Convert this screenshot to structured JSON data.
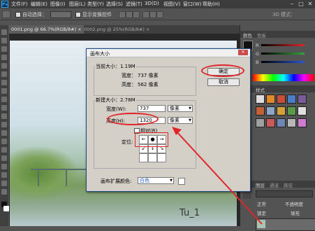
{
  "menubar": {
    "logo": "Ps",
    "items": [
      "文件(F)",
      "编辑(E)",
      "图像(I)",
      "图层(L)",
      "类型(Y)",
      "选择(S)",
      "滤镜(T)",
      "3D(D)",
      "视图(V)",
      "窗口(W)",
      "帮助(H)"
    ],
    "window_controls": [
      "‒",
      "□",
      "✕"
    ]
  },
  "optionsbar": {
    "auto_select_label": "自动选择：",
    "show_transform_label": "显示变换控件",
    "mode_3d_label": "3D 模式："
  },
  "tabs": [
    {
      "label": "0001.png @ 66.7%(RGB/8#)",
      "close": "×",
      "active": true
    },
    {
      "label": "0002.png @ 25%(RGB/8#)",
      "close": "×",
      "active": false
    }
  ],
  "canvas": {
    "watermark": "Tu_1"
  },
  "right_panels": {
    "color_tabs": [
      "颜色",
      "色板"
    ],
    "sliders": [
      {
        "label": "R",
        "color": "#e0262a"
      },
      {
        "label": "G",
        "color": "#2fa83a"
      },
      {
        "label": "B",
        "color": "#2a55d8"
      }
    ],
    "styles_tab": "样式",
    "layers_tabs": [
      "图层",
      "通道",
      "路径"
    ],
    "layers_row1": "正常",
    "layers_row2": "不透明度",
    "layers_row3": "锁定",
    "layers_row4": "填充"
  },
  "dialog": {
    "title": "画布大小",
    "current_size_label": "当前大小：1.19M",
    "current_width_label": "宽度：",
    "current_width_value": "737 像素",
    "current_height_label": "高度：",
    "current_height_value": "562 像素",
    "new_size_label": "新建大小：2.78M",
    "width_label": "宽度(W):",
    "width_value": "737",
    "width_unit": "像素",
    "height_label": "高度(H):",
    "height_value": "1320",
    "height_unit": "像素",
    "relative_label": "相对(R)",
    "anchor_label": "定位:",
    "extension_color_label": "画布扩展颜色:",
    "extension_color_value": "白色",
    "ok_button": "确定",
    "cancel_button": "取消",
    "close_button": "✕"
  },
  "colors": {
    "annotation_red": "#e0262a",
    "dialog_border": "#1f4b86"
  }
}
